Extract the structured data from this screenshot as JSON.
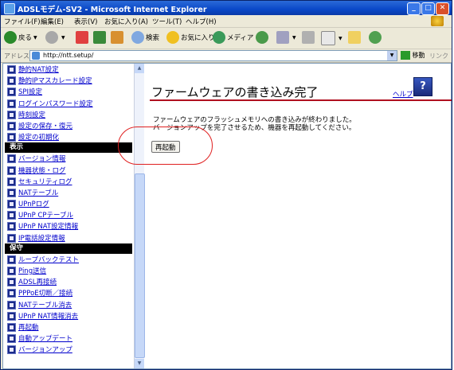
{
  "window": {
    "title": "ADSLモデム-SV2 - Microsoft Internet Explorer"
  },
  "menu": [
    "ファイル(F)",
    "編集(E)",
    "表示(V)",
    "お気に入り(A)",
    "ツール(T)",
    "ヘルプ(H)"
  ],
  "toolbar": {
    "back": "戻る",
    "search": "検索",
    "favorites": "お気に入り",
    "media": "メディア"
  },
  "address": {
    "label": "アドレス(D)",
    "url": "http://ntt.setup/",
    "go": "移動",
    "links": "リンク »"
  },
  "nav": {
    "group1": [
      "静的NAT設定",
      "静的IPマスカレード設定",
      "SPI設定",
      "ログインパスワード設定",
      "時刻設定",
      "設定の保存・復元",
      "設定の初期化"
    ],
    "header_display": "表示",
    "group2": [
      "バージョン情報",
      "機器状態・ログ",
      "セキュリティログ",
      "NATテーブル",
      "UPnPログ",
      "UPnP CPテーブル",
      "UPnP NAT設定情報",
      "IP電話設定情報"
    ],
    "header_maintenance": "保守",
    "group3": [
      "ループバックテスト",
      "Ping送信",
      "ADSL再接続",
      "PPPoE切断／接続",
      "NATテーブル消去",
      "UPnP NAT情報消去",
      "再起動",
      "自動アップデート",
      "バージョンアップ"
    ]
  },
  "main": {
    "title": "ファームウェアの書き込み完了",
    "help": "ヘルプ",
    "message_line1": "ファームウェアのフラッシュメモリへの書き込みが終わりました。",
    "message_line2": "バージョンアップを完了させるため、機器を再起動してください。",
    "restart_button": "再起動"
  },
  "colors": {
    "title_rule": "#b01020",
    "highlight": "#e02020",
    "nav_header_bg": "#000000"
  }
}
